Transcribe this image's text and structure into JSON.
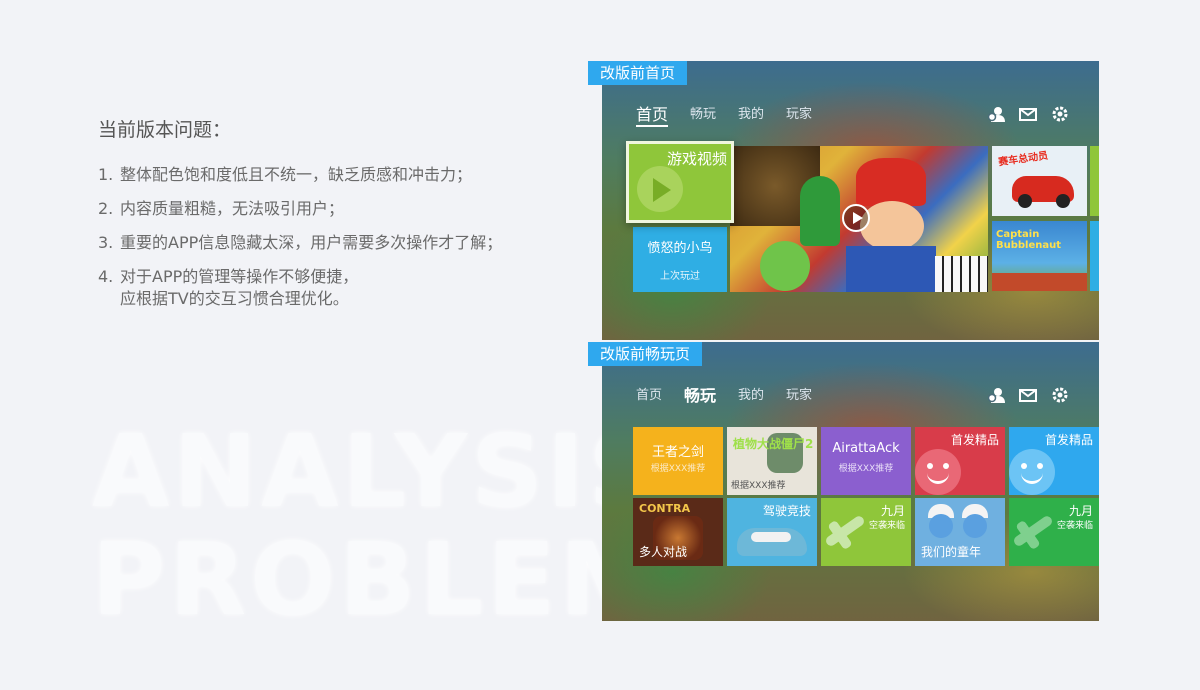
{
  "bg_words": [
    "ANALYSIS",
    "PROBLEM"
  ],
  "issues": {
    "title": "当前版本问题：",
    "items": [
      {
        "num": "1.",
        "lines": [
          "整体配色饱和度低且不统一，缺乏质感和冲击力；"
        ]
      },
      {
        "num": "2.",
        "lines": [
          "内容质量粗糙，无法吸引用户；"
        ]
      },
      {
        "num": "3.",
        "lines": [
          "重要的APP信息隐藏太深，用户需要多次操作才了解；"
        ]
      },
      {
        "num": "4.",
        "lines": [
          "对于APP的管理等操作不够便捷，",
          "应根据TV的交互习惯合理优化。"
        ]
      }
    ]
  },
  "panel1": {
    "tag": "改版前首页",
    "nav": [
      "首页",
      "畅玩",
      "我的",
      "玩家"
    ],
    "tiles": {
      "video": "游戏视频",
      "birds_name": "愤怒的小鸟",
      "birds_sub": "上次玩过",
      "cars_title": "赛车总动员",
      "captain_title": "Captain Bubblenaut"
    }
  },
  "panel2": {
    "tag": "改版前畅玩页",
    "nav": [
      "首页",
      "畅玩",
      "我的",
      "玩家"
    ],
    "row1": [
      {
        "name": "王者之剑",
        "sub": "根据XXX推荐",
        "color": "#f5b21c"
      },
      {
        "name": "植物大战僵尸2",
        "sub": "根据XXX推荐",
        "color": "#e8e4da"
      },
      {
        "name": "AirattaAck",
        "sub": "根据XXX推荐",
        "color": "#8b5fcf"
      },
      {
        "name": "首发精品",
        "color": "#d83c4a"
      },
      {
        "name": "首发精品",
        "color": "#2fa8ee"
      }
    ],
    "row2": [
      {
        "name": "多人对战",
        "logo": "CONTRA",
        "color": "#5a2a18"
      },
      {
        "name": "驾驶竞技",
        "color": "#4fb4e0"
      },
      {
        "name": "九月",
        "sub": "空袭来临",
        "color": "#8fc63a"
      },
      {
        "name": "我们的童年",
        "color": "#6fb0e0"
      },
      {
        "name": "九月",
        "sub": "空袭来临",
        "color": "#2fb04a"
      }
    ]
  },
  "colors": {
    "tag_blue": "#2fa8ee",
    "tile_green": "#8fc63a",
    "tile_blue": "#2faee4"
  },
  "icons": [
    "user-icon",
    "mail-icon",
    "gear-icon"
  ]
}
